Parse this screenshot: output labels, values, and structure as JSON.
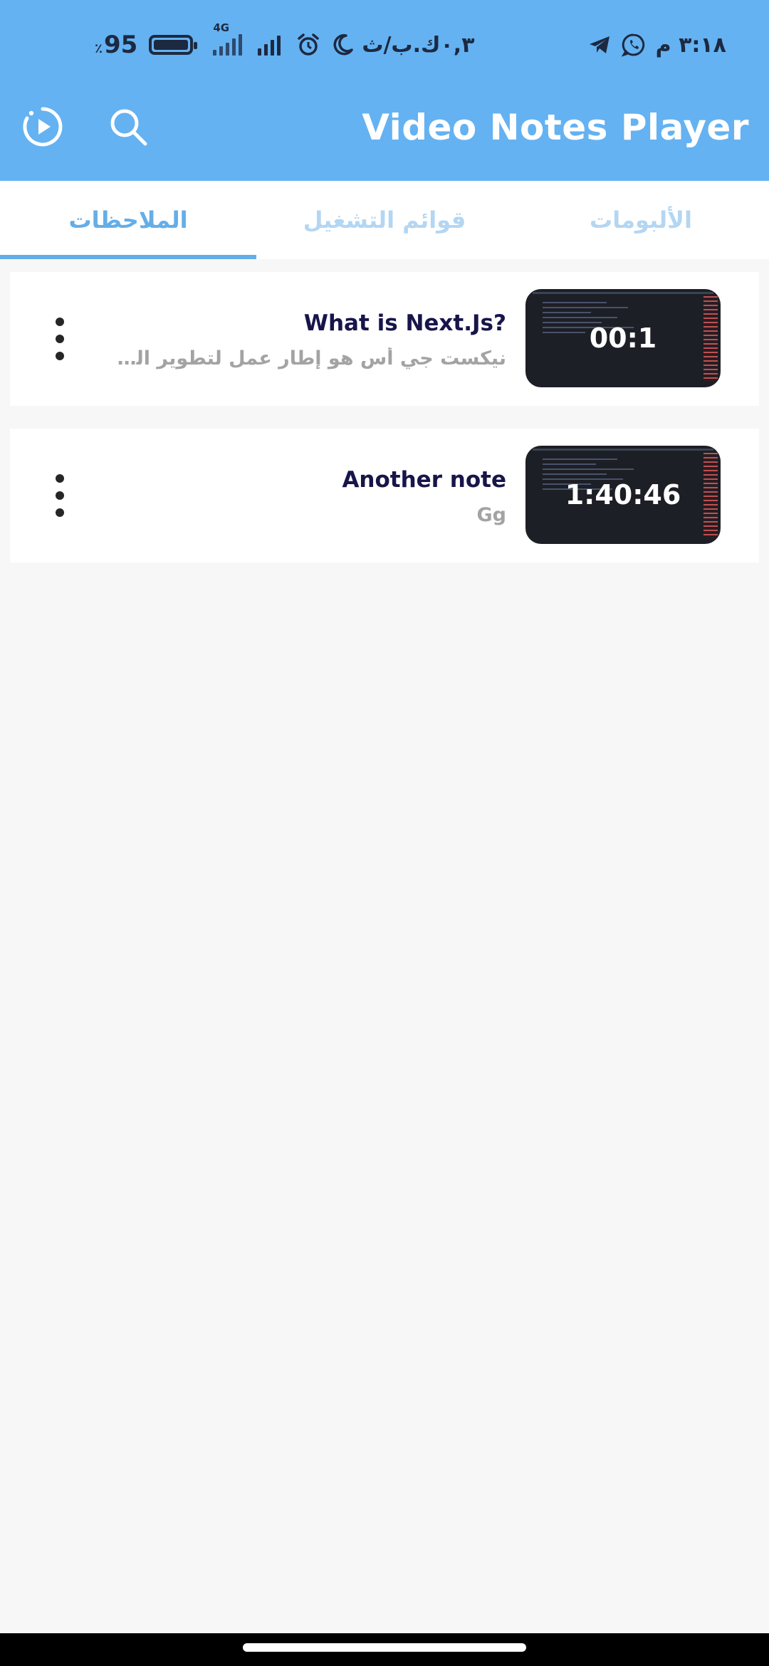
{
  "status_bar": {
    "battery_level": "95",
    "battery_percent_sign": "٪",
    "network_type": "4G",
    "speed": "٠,٣ك.ب/ث",
    "time": "٣:١٨ م"
  },
  "app_bar": {
    "title": "Video Notes Player",
    "icons": [
      "history-play-icon",
      "search-icon"
    ]
  },
  "tabs": [
    {
      "label": "الألبومات",
      "active": false
    },
    {
      "label": "قوائم التشغيل",
      "active": false
    },
    {
      "label": "الملاحظات",
      "active": true
    }
  ],
  "notes": [
    {
      "title": "What is Next.Js?",
      "subtitle": "نيكست جي أس هو إطار عمل لتطوير الوي…",
      "duration": "00:1"
    },
    {
      "title": "Another note",
      "subtitle": "Gg",
      "duration": "1:40:46"
    }
  ],
  "colors": {
    "app_bar": "#64b2f2",
    "active_tab": "#64aee8",
    "inactive_tab": "#b3d6f2",
    "note_title": "#17154a"
  }
}
